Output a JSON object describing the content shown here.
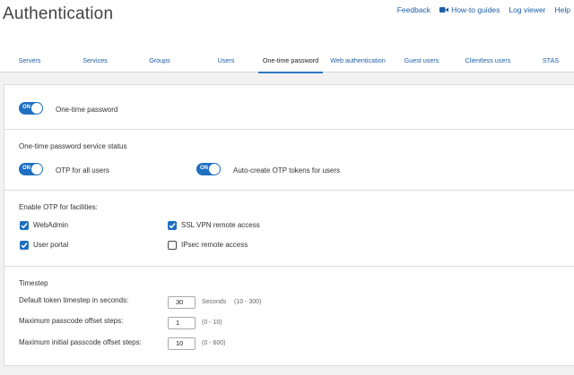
{
  "header": {
    "title": "Authentication",
    "links": {
      "feedback": "Feedback",
      "howto": "How-to guides",
      "log_viewer": "Log viewer",
      "help": "Help"
    }
  },
  "tabs": [
    {
      "label": "Servers"
    },
    {
      "label": "Services"
    },
    {
      "label": "Groups"
    },
    {
      "label": "Users"
    },
    {
      "label": "One-time password"
    },
    {
      "label": "Web authentication"
    },
    {
      "label": "Guest users"
    },
    {
      "label": "Clientless users"
    },
    {
      "label": "STAS"
    }
  ],
  "active_tab": "One-time password",
  "otp": {
    "toggle_text": "ON",
    "enabled": true,
    "label": "One-time password"
  },
  "status": {
    "title": "One-time password service status",
    "otp_all_users": {
      "label": "OTP for all users",
      "toggle_text": "ON",
      "enabled": true
    },
    "auto_create": {
      "label": "Auto-create OTP tokens for users",
      "toggle_text": "ON",
      "enabled": true
    }
  },
  "facilities": {
    "title": "Enable OTP for facilities:",
    "webadmin": {
      "label": "WebAdmin",
      "checked": true
    },
    "ssl_vpn": {
      "label": "SSL VPN remote access",
      "checked": true
    },
    "user_portal": {
      "label": "User portal",
      "checked": true
    },
    "ipsec": {
      "label": "IPsec remote access",
      "checked": false
    }
  },
  "timestep": {
    "title": "Timestep",
    "default_token": {
      "label": "Default token timestep in seconds:",
      "value": "30",
      "unit": "Seconds",
      "range": "(10 - 300)"
    },
    "max_offset": {
      "label": "Maximum passcode offset steps:",
      "value": "1",
      "range": "(0 - 10)"
    },
    "max_initial_offset": {
      "label": "Maximum initial passcode offset steps:",
      "value": "10",
      "range": "(0 - 600)"
    }
  },
  "colors": {
    "accent": "#1e6fbf",
    "link": "#1e5fa6",
    "background": "#f2f2f2"
  }
}
